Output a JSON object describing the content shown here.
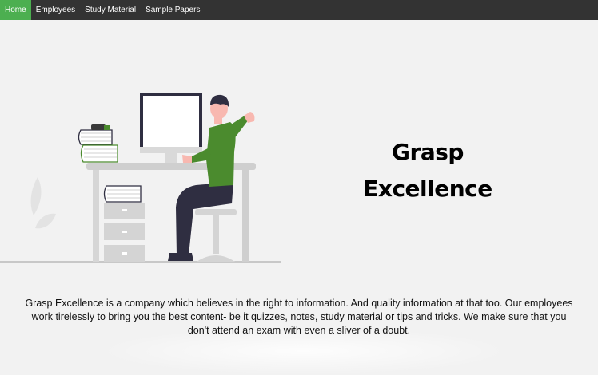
{
  "nav": {
    "items": [
      {
        "label": "Home",
        "active": true
      },
      {
        "label": "Employees",
        "active": false
      },
      {
        "label": "Study Material",
        "active": false
      },
      {
        "label": "Sample Papers",
        "active": false
      }
    ]
  },
  "hero": {
    "title_line1": "Grasp",
    "title_line2": "Excellence"
  },
  "description": "Grasp Excellence is a company which believes in the right to information. And quality information at that too. Our employees work tirelessly to bring you the best content- be it quizzes, notes, study material or tips and tricks. We make sure that you don't attend an exam with even a sliver of a doubt.",
  "colors": {
    "navbar_bg": "#333333",
    "nav_active": "#4caf50",
    "page_bg": "#f2f2f2",
    "accent_shirt": "#4b8b2e",
    "pants": "#2f2e41"
  },
  "illustration": {
    "icons": [
      "person-at-desk-illustration",
      "monitor-icon",
      "books-icon",
      "leaf-icon",
      "chair-icon",
      "drawer-cabinet-icon"
    ]
  }
}
